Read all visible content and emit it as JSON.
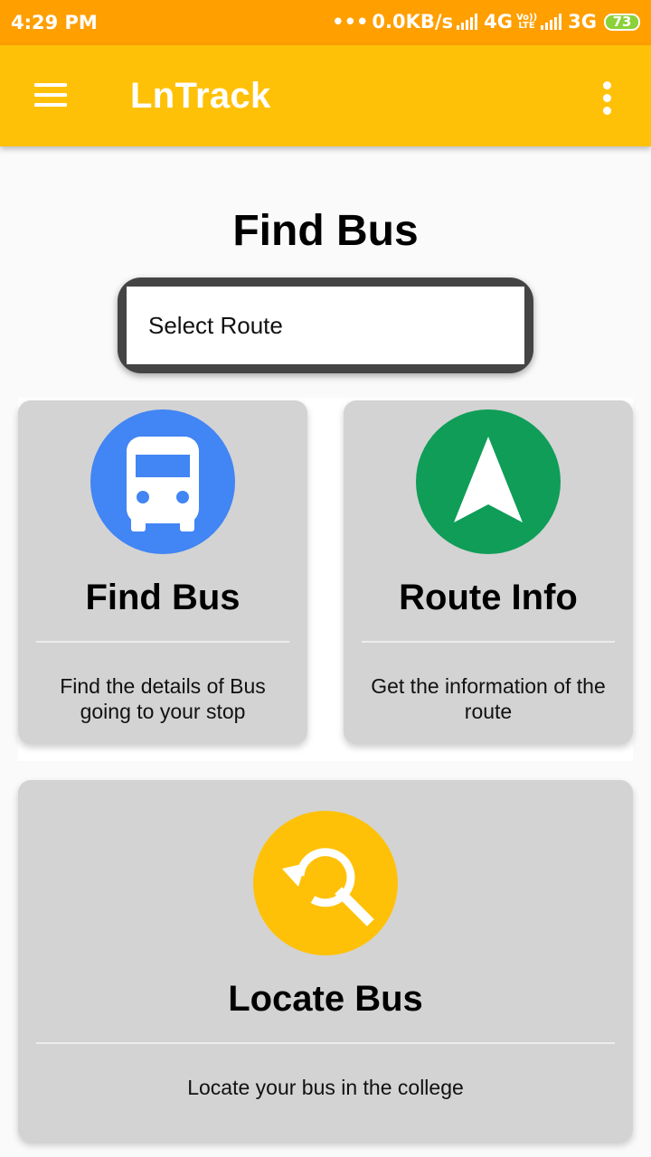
{
  "status_bar": {
    "time": "4:29 PM",
    "network_speed": "0.0KB/s",
    "network_type_1": "4G",
    "volte_top": "Vo))",
    "volte_bottom": "LTE",
    "network_type_2": "3G",
    "battery": "73"
  },
  "app_bar": {
    "title": "LnTrack",
    "menu_icon": "hamburger-menu-icon",
    "overflow_icon": "more-vert-icon"
  },
  "page": {
    "title": "Find Bus",
    "route_select": {
      "placeholder": "Select Route"
    }
  },
  "cards": [
    {
      "title": "Find Bus",
      "description": "Find the details of Bus going to your stop",
      "icon": "bus-icon",
      "color": "#4285f4"
    },
    {
      "title": "Route Info",
      "description": "Get the information of the route",
      "icon": "navigation-arrow-icon",
      "color": "#0f9d58"
    },
    {
      "title": "Locate Bus",
      "description": "Locate your bus in the college",
      "icon": "search-refresh-icon",
      "color": "#ffc107"
    }
  ],
  "colors": {
    "status_bar": "#ff9f00",
    "app_bar": "#ffc107",
    "card_bg": "#d3d3d3",
    "battery": "#8bd13a"
  }
}
